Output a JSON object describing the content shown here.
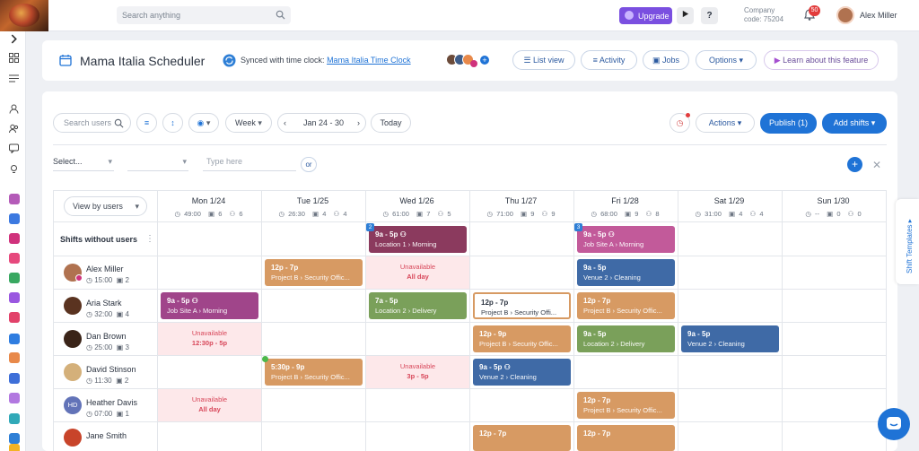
{
  "topbar": {
    "search_placeholder": "Search anything",
    "upgrade_label": "Upgrade",
    "help_label": "?",
    "company_label": "Company",
    "company_code": "code: 75204",
    "notification_count": "50",
    "user_name": "Alex Miller"
  },
  "header": {
    "title": "Mama Italia Scheduler",
    "synced_text": "Synced with time clock:",
    "synced_link": "Mama Italia Time Clock",
    "list_view": "List view",
    "activity": "Activity",
    "jobs": "Jobs",
    "options": "Options",
    "learn": "Learn about this feature"
  },
  "toolbar": {
    "search_users_placeholder": "Search users",
    "range_mode": "Week",
    "date_range": "Jan 24 - 30",
    "today": "Today",
    "actions": "Actions",
    "publish": "Publish (1)",
    "add_shifts": "Add shifts"
  },
  "filter": {
    "select_placeholder": "Select...",
    "type_placeholder": "Type here",
    "or_label": "or"
  },
  "grid": {
    "view_by": "View by users",
    "shifts_without_users": "Shifts without users",
    "days": [
      {
        "name": "Mon 1/24",
        "hours": "49:00",
        "shifts": "6",
        "users": "6"
      },
      {
        "name": "Tue 1/25",
        "hours": "26:30",
        "shifts": "4",
        "users": "4"
      },
      {
        "name": "Wed 1/26",
        "hours": "61:00",
        "shifts": "7",
        "users": "5"
      },
      {
        "name": "Thu 1/27",
        "hours": "71:00",
        "shifts": "9",
        "users": "9"
      },
      {
        "name": "Fri 1/28",
        "hours": "68:00",
        "shifts": "9",
        "users": "8"
      },
      {
        "name": "Sat 1/29",
        "hours": "31:00",
        "shifts": "4",
        "users": "4"
      },
      {
        "name": "Sun 1/30",
        "hours": "--",
        "shifts": "0",
        "users": "0"
      }
    ],
    "unassigned": [
      {
        "time": "9a - 5p",
        "loc": "Location 1 › Morning",
        "count": "2"
      },
      {
        "time": "9a - 5p",
        "loc": "Job Site A › Morning",
        "count": "3"
      }
    ],
    "employees": [
      {
        "name": "Alex Miller",
        "hours": "15:00",
        "shifts": "2"
      },
      {
        "name": "Aria Stark",
        "hours": "32:00",
        "shifts": "4"
      },
      {
        "name": "Dan Brown",
        "hours": "25:00",
        "shifts": "3"
      },
      {
        "name": "David Stinson",
        "hours": "11:30",
        "shifts": "2"
      },
      {
        "name": "Heather Davis",
        "initials": "HD",
        "hours": "07:00",
        "shifts": "1"
      },
      {
        "name": "Jane Smith"
      }
    ],
    "shift_cells": {
      "alex_tue": {
        "time": "12p - 7p",
        "loc": "Project B › Security Offic..."
      },
      "alex_fri": {
        "time": "9a - 5p",
        "loc": "Venue 2 › Cleaning"
      },
      "aria_mon": {
        "time": "9a - 5p",
        "loc": "Job Site A › Morning"
      },
      "aria_wed": {
        "time": "7a - 5p",
        "loc": "Location 2 › Delivery"
      },
      "aria_thu": {
        "time": "12p - 7p",
        "loc": "Project B › Security Offi..."
      },
      "aria_fri": {
        "time": "12p - 7p",
        "loc": "Project B › Security Offic..."
      },
      "dan_thu": {
        "time": "12p - 9p",
        "loc": "Project B › Security Offic..."
      },
      "dan_fri": {
        "time": "9a - 5p",
        "loc": "Location 2 › Delivery"
      },
      "dan_sat": {
        "time": "9a - 5p",
        "loc": "Venue 2 › Cleaning"
      },
      "david_tue": {
        "time": "5:30p - 9p",
        "loc": "Project B › Security Offic..."
      },
      "david_thu": {
        "time": "9a - 5p",
        "loc": "Venue 2 › Cleaning"
      },
      "heather_fri": {
        "time": "12p - 7p",
        "loc": "Project B › Security Offic..."
      },
      "jane_thu": {
        "time": "12p - 7p"
      },
      "jane_fri": {
        "time": "12p - 7p"
      }
    },
    "unavailable": {
      "alex_wed": {
        "label": "Unavailable",
        "detail": "All day"
      },
      "dan_mon": {
        "label": "Unavailable",
        "detail": "12:30p - 5p"
      },
      "david_wed": {
        "label": "Unavailable",
        "detail": "3p - 5p"
      },
      "heather_mon": {
        "label": "Unavailable",
        "detail": "All day"
      }
    }
  },
  "side": {
    "shift_templates": "Shift Templates"
  },
  "colors": {
    "primary": "#1f73d6",
    "upgrade": "#7a4fe0",
    "shift_tan": "#d79a63",
    "shift_blue": "#3f6aa6",
    "shift_green": "#7aa05a",
    "shift_purple": "#8b3a5e",
    "shift_pink": "#c25a9a",
    "unavailable_bg": "#fde8ea"
  }
}
